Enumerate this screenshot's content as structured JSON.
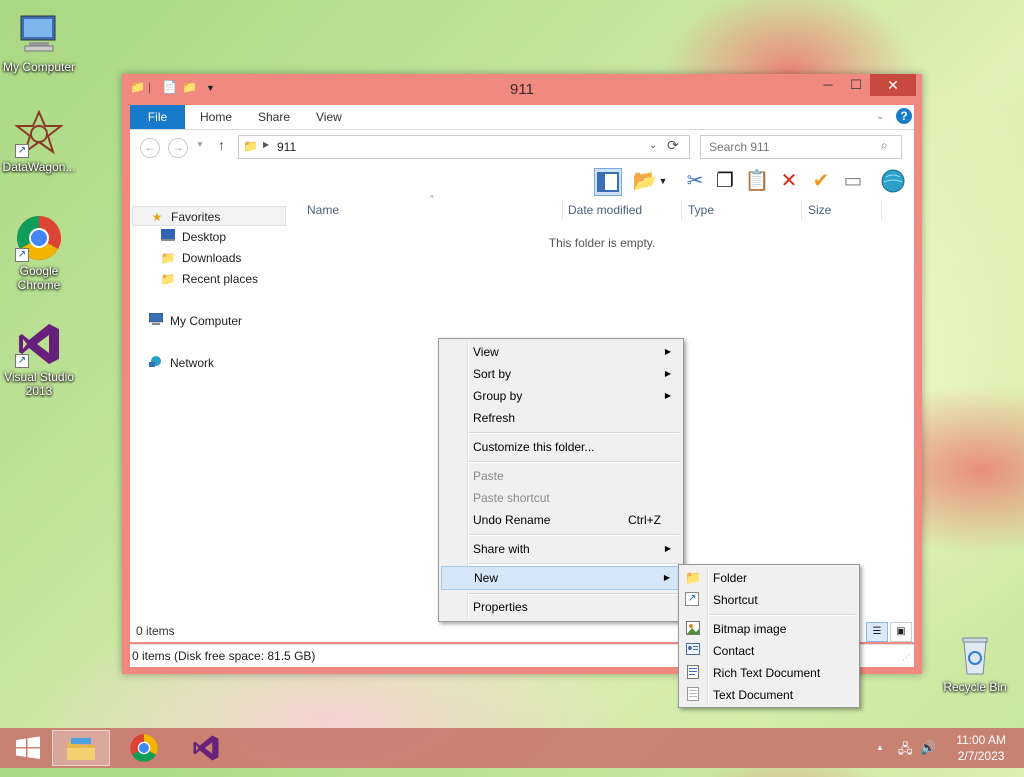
{
  "desktop": {
    "icons": [
      {
        "label": "My Computer"
      },
      {
        "label": "DataWagon..."
      },
      {
        "label": "Google Chrome"
      },
      {
        "label": "Visual Studio 2013"
      },
      {
        "label": "Recycle Bin"
      }
    ]
  },
  "window": {
    "title": "911",
    "tabs": {
      "file": "File",
      "home": "Home",
      "share": "Share",
      "view": "View"
    },
    "address": "911",
    "search_placeholder": "Search 911",
    "columns": {
      "name": "Name",
      "date": "Date modified",
      "type": "Type",
      "size": "Size"
    },
    "empty_message": "This folder is empty.",
    "items_count": "0 items",
    "status": "0 items (Disk free space: 81.5 GB)",
    "nav": {
      "favorites": "Favorites",
      "desktop": "Desktop",
      "downloads": "Downloads",
      "recent": "Recent places",
      "computer": "My Computer",
      "network": "Network"
    }
  },
  "context_menu": {
    "view": "View",
    "sort_by": "Sort by",
    "group_by": "Group by",
    "refresh": "Refresh",
    "customize": "Customize this folder...",
    "paste": "Paste",
    "paste_shortcut": "Paste shortcut",
    "undo_rename": "Undo Rename",
    "undo_shortcut": "Ctrl+Z",
    "share_with": "Share with",
    "new": "New",
    "properties": "Properties"
  },
  "new_submenu": {
    "folder": "Folder",
    "shortcut": "Shortcut",
    "bitmap": "Bitmap image",
    "contact": "Contact",
    "rtf": "Rich Text Document",
    "txt": "Text Document"
  },
  "taskbar": {
    "time": "11:00 AM",
    "date": "2/7/2023"
  }
}
